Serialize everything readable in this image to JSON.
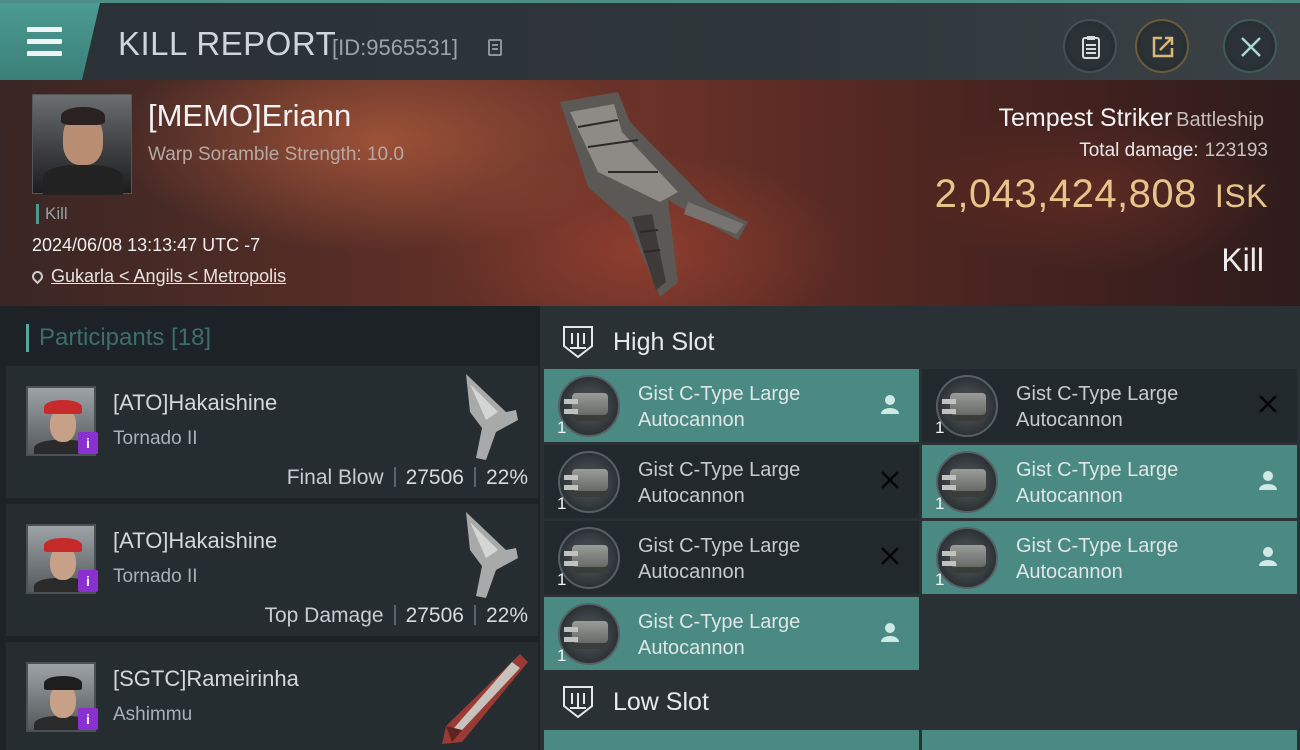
{
  "header": {
    "title": "KILL REPORT",
    "report_id": "[ID:9565531]"
  },
  "victim": {
    "name": "[MEMO]Eriann",
    "subtitle": "Warp Soramble Strength: 10.0",
    "tag": "Kill",
    "datetime": "2024/06/08 13:13:47 UTC -7",
    "location": "Gukarla < Angils < Metropolis",
    "ship_name": "Tempest Striker",
    "ship_class": "Battleship",
    "total_damage_label": "Total damage:",
    "total_damage": "123193",
    "isk_value": "2,043,424,808",
    "isk_unit": "ISK",
    "result": "Kill"
  },
  "participants": {
    "header": "Participants [18]",
    "rows": [
      {
        "name": "[ATO]Hakaishine",
        "ship": "Tornado II",
        "label": "Final Blow",
        "damage": "27506",
        "percent": "22%"
      },
      {
        "name": "[ATO]Hakaishine",
        "ship": "Tornado II",
        "label": "Top Damage",
        "damage": "27506",
        "percent": "22%"
      },
      {
        "name": "[SGTC]Rameirinha",
        "ship": "Ashimmu",
        "label": "",
        "damage": "",
        "percent": ""
      }
    ]
  },
  "fitting": {
    "high_slot_label": "High Slot",
    "low_slot_label": "Low Slot",
    "modules": [
      {
        "line1": "Gist C-Type Large",
        "line2": "Autocannon",
        "qty": "1",
        "state": "user-icon"
      },
      {
        "line1": "Gist C-Type Large",
        "line2": "Autocannon",
        "qty": "1",
        "state": "destroyed-icon"
      },
      {
        "line1": "Gist C-Type Large",
        "line2": "Autocannon",
        "qty": "1",
        "state": "destroyed-icon"
      },
      {
        "line1": "Gist C-Type Large",
        "line2": "Autocannon",
        "qty": "1",
        "state": "user-icon"
      },
      {
        "line1": "Gist C-Type Large",
        "line2": "Autocannon",
        "qty": "1",
        "state": "destroyed-icon"
      },
      {
        "line1": "Gist C-Type Large",
        "line2": "Autocannon",
        "qty": "1",
        "state": "user-icon"
      },
      {
        "line1": "Gist C-Type Large",
        "line2": "Autocannon",
        "qty": "1",
        "state": "user-icon"
      }
    ]
  },
  "colors": {
    "accent_teal": "#4a8a83",
    "isk_gold": "#e7c58a",
    "badge_purple": "#8a2fd0"
  }
}
